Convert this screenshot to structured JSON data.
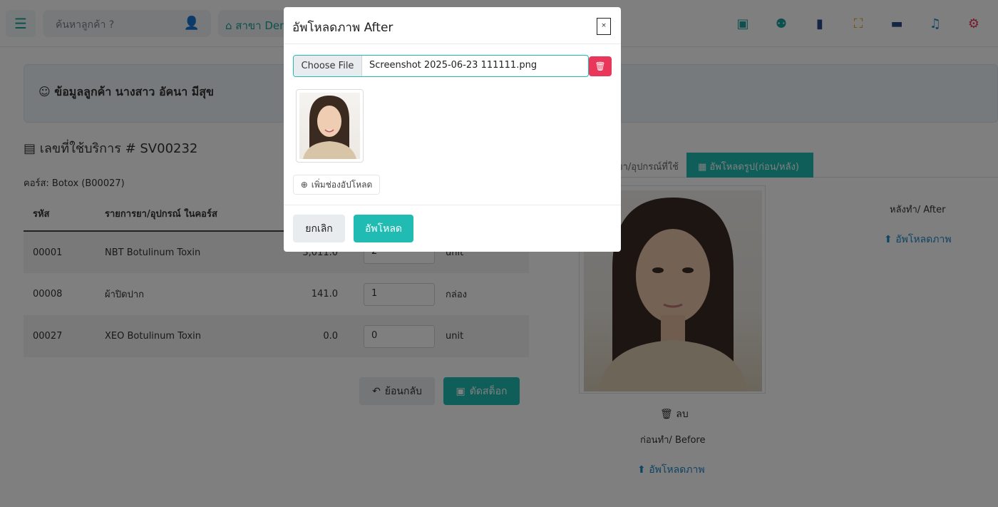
{
  "topbar": {
    "search_placeholder": "ค้นหาลูกค้า ?",
    "branch_label": "สาขา Demo",
    "icons": [
      "menu-icon",
      "add-user-icon",
      "home-icon",
      "new-document-icon",
      "users-icon",
      "stock-icon",
      "fullscreen-icon",
      "folder-icon",
      "bell-icon",
      "gear-icon"
    ]
  },
  "customer": {
    "title": "ข้อมูลลูกค้า นางสาว อัคนา มีสุข"
  },
  "service": {
    "title": "เลขที่ใช้บริการ # SV00232",
    "course": "คอร์ส: Botox (B00027)"
  },
  "table": {
    "headers": {
      "code": "รหัส",
      "item": "รายการยา/อุปกรณ์ ในคอร์ส"
    },
    "rows": [
      {
        "code": "00001",
        "name": "NBT Botulinum Toxin",
        "price": "3,011.0",
        "qty": "2",
        "unit": "unit"
      },
      {
        "code": "00008",
        "name": "ผ้าปิดปาก",
        "price": "141.0",
        "qty": "1",
        "unit": "กล่อง"
      },
      {
        "code": "00027",
        "name": "XEO Botulinum Toxin",
        "price": "0.0",
        "qty": "0",
        "unit": "unit"
      }
    ]
  },
  "actions": {
    "back": "ย้อนกลับ",
    "cut_stock": "ตัดสต็อก"
  },
  "tabs": {
    "equipment": "ยา/อุปกรณ์ที่ใช้",
    "upload_photos": "อัพโหลดรูป(ก่อน/หลัง)"
  },
  "photos": {
    "delete": "ลบ",
    "before_label": "ก่อนทำ/ Before",
    "after_label": "หลังทำ/ After",
    "upload_before": "อัพโหลดภาพ",
    "upload_after": "อัพโหลดภาพ"
  },
  "modal": {
    "title": "อัพโหลดภาพ After",
    "close": "×",
    "choose_file": "Choose File",
    "file_name": "Screenshot 2025-06-23 111111.png",
    "add_slot": "เพิ่มช่องอัปโหลด",
    "cancel": "ยกเลิก",
    "upload": "อัพโหลด"
  },
  "colors": {
    "accent": "#20bcb3",
    "danger": "#e8375a",
    "link": "#1e88c8"
  }
}
